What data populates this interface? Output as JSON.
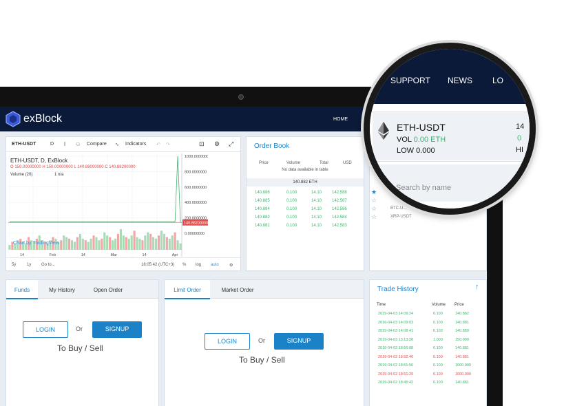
{
  "navbar": {
    "brand": "exBlock",
    "home": "HOME"
  },
  "magnifier": {
    "nav": [
      "SUPPORT",
      "NEWS",
      "LO"
    ],
    "symbol": "ETH-USDT",
    "vol_label": "VOL",
    "vol_value": "0.00 ETH",
    "low_label": "LOW",
    "low_value": "0.000",
    "right_top": "14",
    "right_mid": "0",
    "right_bottom": "HI",
    "search_placeholder": "Search by name"
  },
  "chart": {
    "toolbar": {
      "symbol": "ETH-USDT",
      "interval": "D",
      "compare": "Compare",
      "indicators": "Indicators"
    },
    "legend_title": "ETH-USDT, D, ExBlock",
    "ohlc": "O 150.00000000  H 150.00000000  L 140.88000000  C 140.88200000",
    "volume": "Volume (20)",
    "volume_value": "1  n/a",
    "watermark": "Chart by TradingView",
    "footer": {
      "r5y": "5y",
      "r1y": "1y",
      "goto": "Go to...",
      "time": "18:05:42 (UTC+3)",
      "pct": "%",
      "log": "log",
      "auto": "auto"
    }
  },
  "chart_data": {
    "type": "line",
    "x_ticks": [
      "14",
      "Feb",
      "14",
      "Mar",
      "14",
      "Apr"
    ],
    "y_ticks": [
      "1000.0000000",
      "800.0000000",
      "600.0000000",
      "400.0000000",
      "200.0000000",
      "0.00000000"
    ],
    "ylim": [
      0,
      1000
    ],
    "price_label": "140.88200000",
    "series": [
      {
        "values": [
          150,
          150,
          150,
          150,
          150,
          150,
          150,
          150,
          150,
          150,
          150,
          150,
          150,
          150,
          150,
          150,
          150,
          150,
          150,
          150,
          150,
          150,
          150,
          150,
          150,
          150,
          150,
          150,
          150,
          150,
          150,
          150,
          150,
          150,
          150,
          150,
          150,
          150,
          150,
          150,
          150,
          150,
          150,
          150,
          150,
          150,
          150,
          150,
          150,
          150,
          150,
          150,
          150,
          150,
          150,
          150,
          150,
          150,
          150,
          150,
          150,
          150,
          1000,
          140.88
        ]
      }
    ],
    "volume": [
      3,
      5,
      4,
      6,
      7,
      5,
      4,
      8,
      6,
      5,
      7,
      9,
      6,
      5,
      4,
      6,
      8,
      7,
      5,
      6,
      9,
      8,
      7,
      6,
      5,
      8,
      10,
      7,
      6,
      5,
      7,
      9,
      8,
      6,
      7,
      11,
      9,
      8,
      6,
      7,
      10,
      13,
      9,
      8,
      7,
      9,
      12,
      8,
      7,
      6,
      9,
      11,
      10,
      8,
      7,
      9,
      12,
      10,
      8,
      7,
      9,
      11,
      6,
      4
    ],
    "grid": true
  },
  "orderbook": {
    "title": "Order Book",
    "headers": [
      "Price",
      "Volume",
      "Total",
      "USD"
    ],
    "no_data": "No data available in table",
    "mid_price": "140.882 ETH",
    "rows": [
      [
        "140.886",
        "0.100",
        "14.10",
        "142.588"
      ],
      [
        "140.885",
        "0.100",
        "14.10",
        "142.587"
      ],
      [
        "140.884",
        "0.100",
        "14.10",
        "142.586"
      ],
      [
        "140.882",
        "0.100",
        "14.10",
        "142.584"
      ],
      [
        "140.881",
        "0.100",
        "14.10",
        "142.583"
      ]
    ]
  },
  "markets": [
    "BTC-U...",
    "XRP-USDT"
  ],
  "funds": {
    "tabs": [
      "Funds",
      "My History",
      "Open Order"
    ],
    "login": "LOGIN",
    "or": "Or",
    "signup": "SIGNUP",
    "tobuy": "To Buy / Sell"
  },
  "limit": {
    "tabs": [
      "Limit Order",
      "Market Order"
    ],
    "login": "LOGIN",
    "or": "Or",
    "signup": "SIGNUP",
    "tobuy": "To Buy / Sell"
  },
  "trade_history": {
    "title": "Trade History",
    "headers": [
      "Time",
      "Volume",
      "Price"
    ],
    "rows": [
      {
        "time": "2019-04-03 14:09:24",
        "vol": "0.100",
        "price": "140.882",
        "side": "buy"
      },
      {
        "time": "2019-04-03 14:09:03",
        "vol": "0.100",
        "price": "140.881",
        "side": "buy"
      },
      {
        "time": "2019-04-03 14:08:41",
        "vol": "0.100",
        "price": "140.880",
        "side": "buy"
      },
      {
        "time": "2019-04-03 13:13:28",
        "vol": "1.000",
        "price": "150.000",
        "side": "buy"
      },
      {
        "time": "2019-04-02 18:56:08",
        "vol": "0.100",
        "price": "140.881",
        "side": "buy"
      },
      {
        "time": "2019-04-02 18:52:46",
        "vol": "0.100",
        "price": "140.881",
        "side": "sell"
      },
      {
        "time": "2019-04-02 18:51:56",
        "vol": "0.100",
        "price": "1000.000",
        "side": "buy"
      },
      {
        "time": "2019-04-02 18:51:29",
        "vol": "0.100",
        "price": "1000.000",
        "side": "sell"
      },
      {
        "time": "2019-04-02 18:45:42",
        "vol": "0.100",
        "price": "140.881",
        "side": "buy"
      }
    ]
  },
  "colors": {
    "accent": "#1b82c8",
    "nav": "#0c1a3a",
    "buy": "#3bb46c",
    "sell": "#e44d4d"
  }
}
